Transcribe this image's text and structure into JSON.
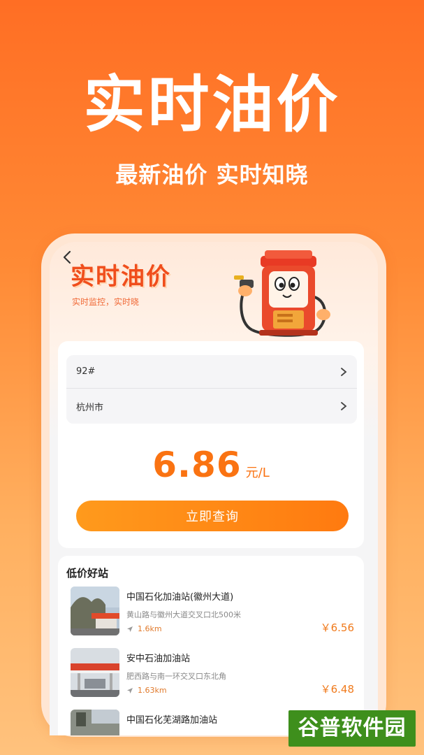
{
  "hero": {
    "title": "实时油价",
    "subtitle": "最新油价 实时知晓"
  },
  "banner": {
    "title": "实时油价",
    "subtitle": "实时监控，实时晓"
  },
  "form": {
    "fuel_grade": "92#",
    "city": "杭州市",
    "price": "6.86",
    "unit": "元/L",
    "query_label": "立即查询"
  },
  "list": {
    "title": "低价好站",
    "stations": [
      {
        "name": "中国石化加油站(徽州大道)",
        "address": "黄山路与徽州大道交叉口北500米",
        "distance": "1.6km",
        "price": "￥6.56"
      },
      {
        "name": "安中石油加油站",
        "address": "肥西路与南一环交叉口东北角",
        "distance": "1.63km",
        "price": "￥6.48"
      },
      {
        "name": "中国石化芜湖路加油站",
        "address": "",
        "distance": "",
        "price": ""
      }
    ]
  },
  "watermark": {
    "text": "谷普软件园"
  },
  "colors": {
    "accent": "#fa7312",
    "background_top": "#ff6e24",
    "background_bottom": "#ffc27d",
    "watermark": "#3e8f1c"
  },
  "icons": [
    "back-arrow-icon",
    "chevron-right-icon",
    "navigation-arrow-icon",
    "fuel-pump-mascot-icon"
  ]
}
